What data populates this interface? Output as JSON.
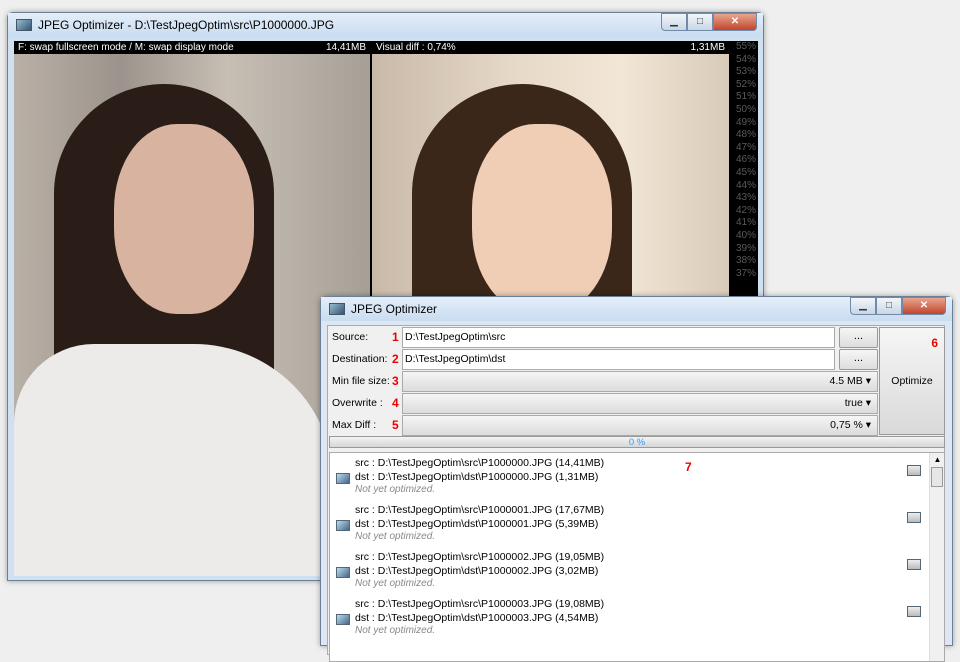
{
  "viewer_window": {
    "title": "JPEG Optimizer - D:\\TestJpegOptim\\src\\P1000000.JPG",
    "left_info": "F: swap fullscreen mode / M: swap display mode",
    "left_size": "14,41MB",
    "right_info": "Visual diff : 0,74%",
    "right_size": "1,31MB",
    "scale": [
      "55%",
      "54%",
      "53%",
      "52%",
      "51%",
      "50%",
      "49%",
      "48%",
      "47%",
      "46%",
      "45%",
      "44%",
      "43%",
      "42%",
      "41%",
      "40%",
      "39%",
      "38%",
      "37%"
    ]
  },
  "main_window": {
    "title": "JPEG Optimizer",
    "fields": [
      {
        "label": "Source:",
        "num": "1",
        "value": "D:\\TestJpegOptim\\src"
      },
      {
        "label": "Destination:",
        "num": "2",
        "value": "D:\\TestJpegOptim\\dst"
      },
      {
        "label": "Min file size:",
        "num": "3",
        "value": "4.5 MB"
      },
      {
        "label": "Overwrite :",
        "num": "4",
        "value": "true"
      },
      {
        "label": "Max Diff :",
        "num": "5",
        "value": "0,75 %"
      }
    ],
    "browse_label": "...",
    "optimize_label": "Optimize",
    "optimize_num": "6",
    "progress_text": "0 %",
    "list_num": "7",
    "items": [
      {
        "src": "src : D:\\TestJpegOptim\\src\\P1000000.JPG (14,41MB)",
        "dst": "dst : D:\\TestJpegOptim\\dst\\P1000000.JPG (1,31MB)",
        "note": "Not yet optimized."
      },
      {
        "src": "src : D:\\TestJpegOptim\\src\\P1000001.JPG (17,67MB)",
        "dst": "dst : D:\\TestJpegOptim\\dst\\P1000001.JPG (5,39MB)",
        "note": "Not yet optimized."
      },
      {
        "src": "src : D:\\TestJpegOptim\\src\\P1000002.JPG (19,05MB)",
        "dst": "dst : D:\\TestJpegOptim\\dst\\P1000002.JPG (3,02MB)",
        "note": "Not yet optimized."
      },
      {
        "src": "src : D:\\TestJpegOptim\\src\\P1000003.JPG (19,08MB)",
        "dst": "dst : D:\\TestJpegOptim\\dst\\P1000003.JPG (4,54MB)",
        "note": "Not yet optimized."
      }
    ]
  }
}
